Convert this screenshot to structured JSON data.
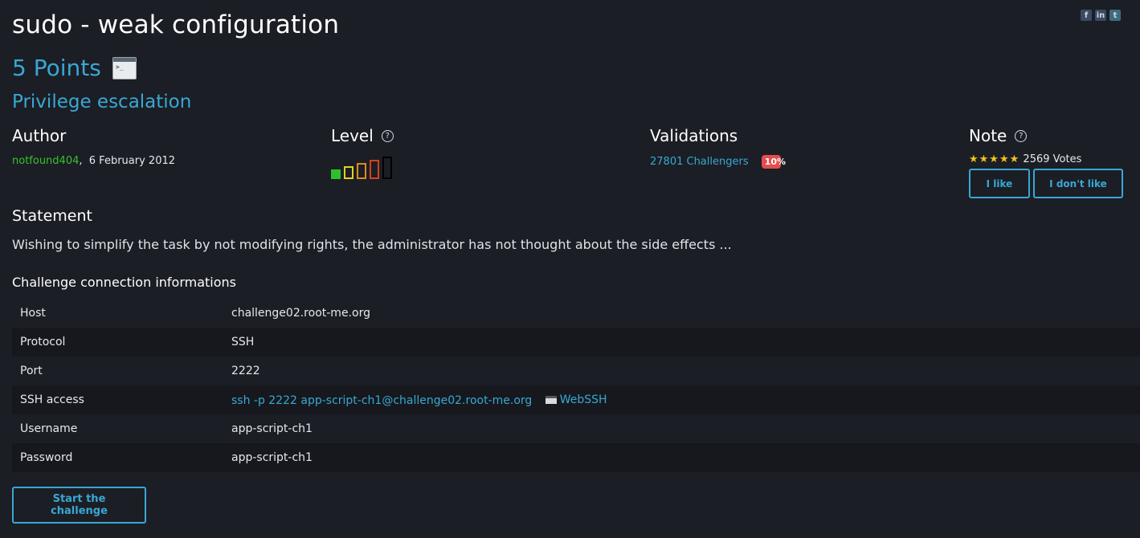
{
  "share": {
    "facebook": "f",
    "linkedin": "in",
    "twitter": "t"
  },
  "challenge": {
    "title": "sudo - weak configuration",
    "points": "5 Points",
    "terminal_icon_glyph": ">_",
    "category": "Privilege escalation"
  },
  "author": {
    "heading": "Author",
    "name": "notfound404",
    "separator": ",",
    "date": "6 February 2012"
  },
  "level": {
    "heading": "Level",
    "help_glyph": "?",
    "current_level": 1,
    "max_level": 5,
    "colors": [
      "#2fbf2a",
      "#e0d21e",
      "#e08a1e",
      "#d8401e",
      "#000000"
    ]
  },
  "validations": {
    "heading": "Validations",
    "challengers": "27801 Challengers",
    "percent": "10%"
  },
  "note": {
    "heading": "Note",
    "help_glyph": "?",
    "stars": "★★★★★",
    "votes": "2569 Votes",
    "like_label": "I like",
    "dislike_label": "I don't like"
  },
  "statement": {
    "heading": "Statement",
    "text": "Wishing to simplify the task by not modifying rights, the administrator has not thought about the side effects ..."
  },
  "connection": {
    "heading": "Challenge connection informations",
    "rows": [
      {
        "key": "Host",
        "value": "challenge02.root-me.org"
      },
      {
        "key": "Protocol",
        "value": "SSH"
      },
      {
        "key": "Port",
        "value": "2222"
      },
      {
        "key": "SSH access",
        "value": "ssh -p 2222 app-script-ch1@challenge02.root-me.org",
        "extra": "WebSSH"
      },
      {
        "key": "Username",
        "value": "app-script-ch1"
      },
      {
        "key": "Password",
        "value": "app-script-ch1"
      }
    ]
  },
  "start_label": "Start the challenge",
  "colors": {
    "background": "#1b1e25",
    "accent": "#3aa7d4",
    "author": "#38c22a",
    "badge": "#e74c4c",
    "stars": "#f2c31c"
  }
}
